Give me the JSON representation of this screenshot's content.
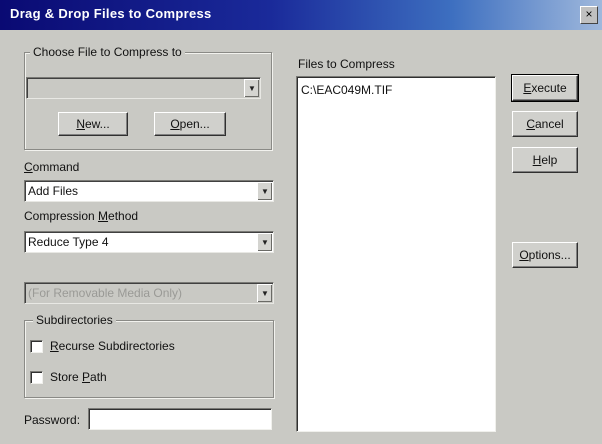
{
  "window": {
    "title": "Drag & Drop Files to Compress",
    "close_glyph": "×"
  },
  "choose_file": {
    "label": "Choose File to Compress to",
    "new_button": {
      "access_key": "N",
      "rest": "ew..."
    },
    "open_button": {
      "access_key": "O",
      "rest": "pen..."
    }
  },
  "command": {
    "label_key": "C",
    "label_rest": "ommand",
    "selected": "Add Files"
  },
  "compression": {
    "label_pre": "Compression ",
    "label_key": "M",
    "label_rest": "ethod",
    "selected": "Reduce Type 4"
  },
  "span_mode": {
    "selected": "(For Removable Media Only)"
  },
  "subdirectories": {
    "label": "Subdirectories",
    "recurse": {
      "key": "R",
      "rest": "ecurse Subdirectories",
      "checked": false
    },
    "store_path": {
      "pre": "Store ",
      "key": "P",
      "rest": "ath",
      "checked": false
    }
  },
  "password": {
    "label": "Password:",
    "value": ""
  },
  "files": {
    "label": "Files to Compress",
    "items": [
      "C:\\EAC049M.TIF"
    ]
  },
  "buttons": {
    "execute": {
      "key": "E",
      "rest": "xecute"
    },
    "cancel": {
      "key": "C",
      "rest": "ancel"
    },
    "help": {
      "key": "H",
      "rest": "elp"
    },
    "options": {
      "key": "O",
      "rest": "ptions..."
    }
  },
  "colors": {
    "face": "#c9c9c4",
    "title_start": "#0a0a73",
    "title_end": "#9fb8dc"
  }
}
